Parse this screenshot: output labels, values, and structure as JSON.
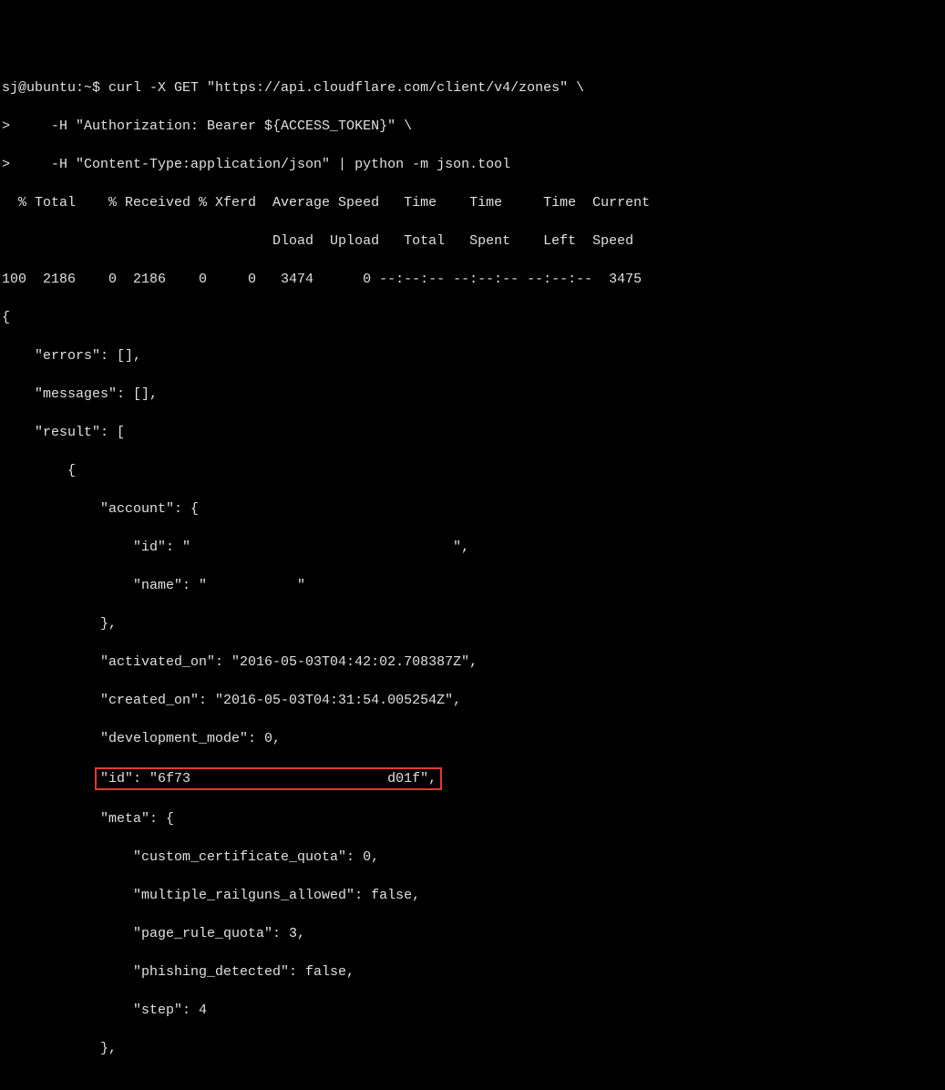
{
  "terminal": {
    "line1": "sj@ubuntu:~$ curl -X GET \"https://api.cloudflare.com/client/v4/zones\" \\",
    "line2": ">     -H \"Authorization: Bearer ${ACCESS_TOKEN}\" \\",
    "line3": ">     -H \"Content-Type:application/json\" | python -m json.tool",
    "line4": "  % Total    % Received % Xferd  Average Speed   Time    Time     Time  Current",
    "line5": "                                 Dload  Upload   Total   Spent    Left  Speed",
    "line6": "100  2186    0  2186    0     0   3474      0 --:--:-- --:--:-- --:--:--  3475",
    "line7": "{",
    "line8": "    \"errors\": [],",
    "line9": "    \"messages\": [],",
    "line10": "    \"result\": [",
    "line11": "        {",
    "line12": "            \"account\": {",
    "line13": "                \"id\": \"                                \",",
    "line14": "                \"name\": \"           \"",
    "line15": "            },",
    "line16": "            \"activated_on\": \"2016-05-03T04:42:02.708387Z\",",
    "line17": "            \"created_on\": \"2016-05-03T04:31:54.005254Z\",",
    "line18": "            \"development_mode\": 0,",
    "line19_highlighted": "\"id\": \"6f73                        d01f\",",
    "line19_prefix": "            ",
    "line20": "            \"meta\": {",
    "line21": "                \"custom_certificate_quota\": 0,",
    "line22": "                \"multiple_railguns_allowed\": false,",
    "line23": "                \"page_rule_quota\": 3,",
    "line24": "                \"phishing_detected\": false,",
    "line25": "                \"step\": 4",
    "line26": "            },"
  }
}
